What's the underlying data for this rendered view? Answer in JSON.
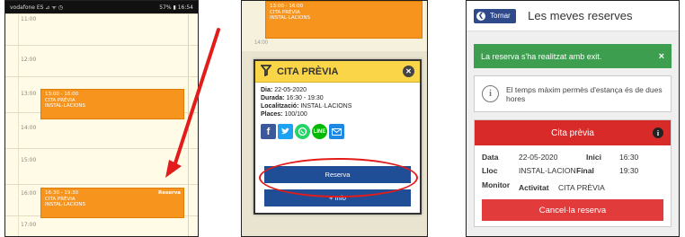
{
  "panel1": {
    "status_left": "vodafone ES ⊿ ᯤ ◷",
    "status_right": "57% ▮ 16:54",
    "hours": [
      "11:00",
      "12:00",
      "13:00",
      "14:00",
      "15:00",
      "16:00",
      "17:00"
    ],
    "event1": {
      "time": "13:00 - 16:00",
      "title": "CITA PRÈVIA",
      "place": "INSTAL·LACIONS"
    },
    "event2": {
      "time": "16:30 - 19:30",
      "title": "CITA PRÈVIA",
      "place": "INSTAL·LACIONS",
      "action": "Reserva"
    }
  },
  "panel2": {
    "event_time": "13:00 - 16:00",
    "event_title": "CITA PRÈVIA",
    "event_place": "INSTAL·LACIONS",
    "hour_label": "14:00",
    "modal": {
      "title": "CITA PRÈVIA",
      "close": "✕",
      "dia_label": "Dia:",
      "dia_value": "22-05-2020",
      "durada_label": "Durada:",
      "durada_value": "16:30 - 19:30",
      "loc_label": "Localització:",
      "loc_value": "INSTAL·LACIONS",
      "places_label": "Places:",
      "places_value": "100/100",
      "reserve_button": "Reserva",
      "info_button": "+ Info"
    }
  },
  "panel3": {
    "back_label": "Tornar",
    "page_title": "Les meves reserves",
    "alert_text": "La reserva s'ha realitzat amb exit.",
    "alert_close": "×",
    "info_text": "El temps màxim permès d'estança és de dues hores",
    "card_title": "Cita prèvia",
    "data_label": "Data",
    "data_value": "22-05-2020",
    "inici_label": "Inici",
    "inici_value": "16:30",
    "lloc_label": "Lloc",
    "lloc_value": "INSTAL·LACION",
    "final_label": "Final",
    "final_value": "19:30",
    "monitor_label": "Monitor",
    "activitat_label": "Activitat",
    "activitat_value": "CITA PRÈVIA",
    "cancel_button": "Cancel·la reserva"
  },
  "colors": {
    "event": "#f7941d",
    "modal_header": "#fbd548",
    "button_blue": "#1f4e96",
    "success": "#3c9e4e",
    "danger": "#d92a2a",
    "annotation": "#e21b1b"
  },
  "icons": [
    "filter-icon",
    "close-icon",
    "facebook-icon",
    "twitter-icon",
    "whatsapp-icon",
    "line-icon",
    "email-icon",
    "back-chevron-icon",
    "info-icon"
  ]
}
